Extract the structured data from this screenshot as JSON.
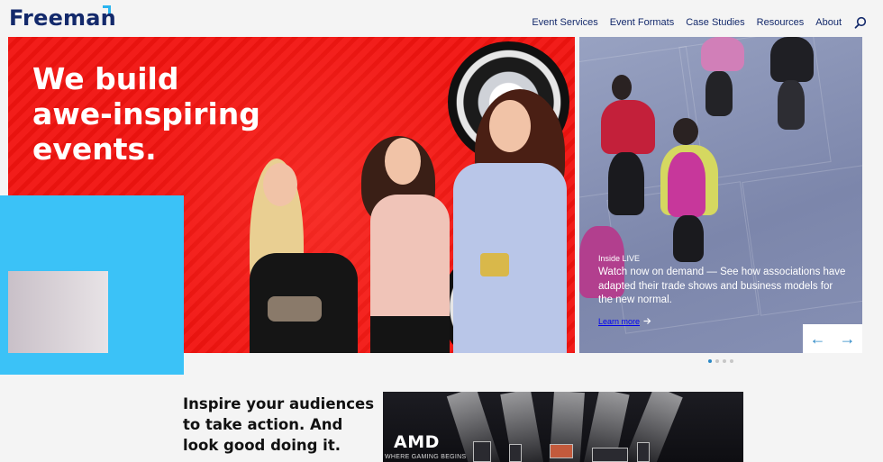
{
  "header": {
    "logo": "Freeman",
    "nav": [
      "Event Services",
      "Event Formats",
      "Case Studies",
      "Resources",
      "About"
    ]
  },
  "hero": {
    "title": "We build awe-inspiring events."
  },
  "side_card": {
    "kicker": "Inside LIVE",
    "text": "Watch now on demand — See how associations have adapted their trade shows and business models for the new normal.",
    "link": "Learn more"
  },
  "carousel": {
    "prev": "←",
    "next": "→",
    "slide_count": 4,
    "active_slide": 1
  },
  "feature": {
    "heading": "Inspire your audiences to take action. And look good doing it.",
    "amd_logo": "AMD",
    "amd_tagline": "WHERE GAMING BEGINS"
  },
  "colors": {
    "brand_navy": "#13296b",
    "accent_blue": "#3bc2f7",
    "hero_red": "#f21d1a",
    "link_blue": "#2b88c6"
  }
}
